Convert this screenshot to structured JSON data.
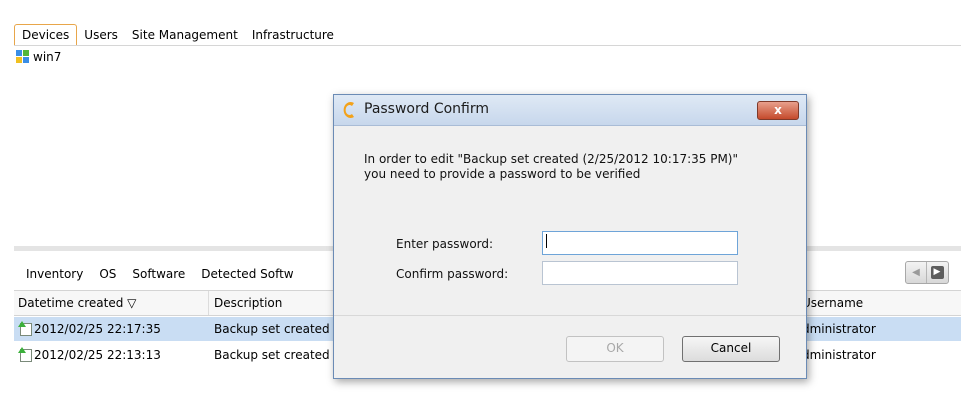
{
  "top_tabs": [
    "Devices",
    "Users",
    "Site Management",
    "Infrastructure"
  ],
  "active_top_tab": "Devices",
  "tree": {
    "item": "win7"
  },
  "bottom_tabs": [
    "Inventory",
    "OS",
    "Software",
    "Detected Softw"
  ],
  "grid": {
    "columns": [
      "Datetime created ▽",
      "Description",
      "Username"
    ],
    "rows": [
      {
        "datetime": "2012/02/25 22:17:35",
        "description": "Backup set created",
        "username": "dministrator",
        "selected": true
      },
      {
        "datetime": "2012/02/25 22:13:13",
        "description": "Backup set created",
        "username": "dministrator",
        "selected": false
      }
    ]
  },
  "dialog": {
    "title": "Password Confirm",
    "close_label": "x",
    "message_line1": "In order to edit \"Backup set created (2/25/2012  10:17:35 PM)\"",
    "message_line2": "you need to provide a password to be verified",
    "enter_label": "Enter password:",
    "confirm_label": "Confirm password:",
    "enter_value": "",
    "confirm_value": "",
    "ok_label": "OK",
    "cancel_label": "Cancel"
  },
  "icons": {
    "nav_prev": "chevron-left-icon",
    "nav_next": "chevron-right-icon",
    "dialog_logo": "app-logo-icon",
    "row_icon": "backup-doc-icon",
    "device_icon": "windows-icon"
  },
  "colors": {
    "selected_row": "#c9ddf3",
    "active_tab_border": "#e8a64a",
    "close_button": "#c44a2c"
  }
}
